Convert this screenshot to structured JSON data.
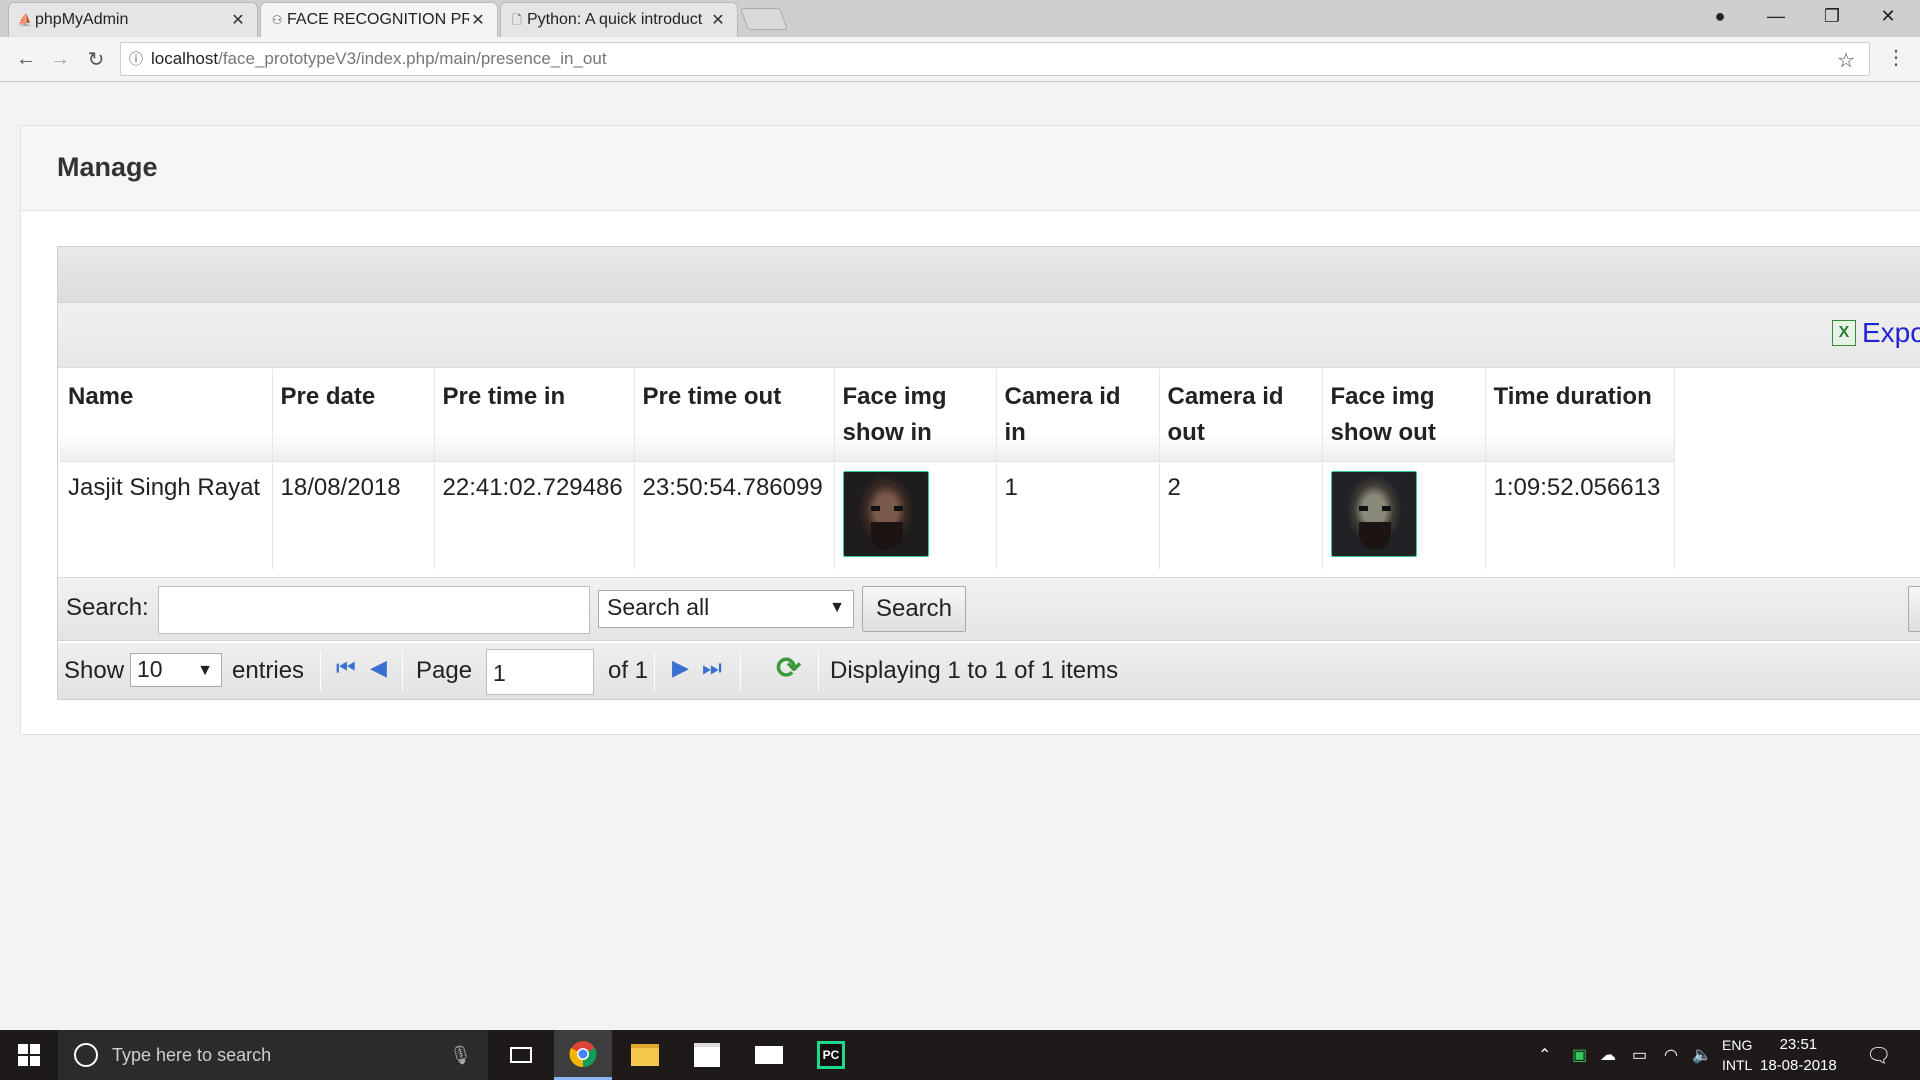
{
  "browser": {
    "tabs": [
      {
        "title": "phpMyAdmin",
        "icon": "phpmyadmin-icon"
      },
      {
        "title": "FACE RECOGNITION PRO",
        "icon": "face-recognition-icon"
      },
      {
        "title": "Python: A quick introduct",
        "icon": "document-icon"
      }
    ],
    "url_host": "localhost",
    "url_path": "/face_prototypeV3/index.php/main/presence_in_out"
  },
  "page": {
    "title": "Manage",
    "export_label": "Expo",
    "table": {
      "headers": [
        {
          "line1": "Name",
          "line2": ""
        },
        {
          "line1": "Pre date",
          "line2": ""
        },
        {
          "line1": "Pre time in",
          "line2": ""
        },
        {
          "line1": "Pre time out",
          "line2": ""
        },
        {
          "line1": "Face img",
          "line2": "show in"
        },
        {
          "line1": "Camera id",
          "line2": "in"
        },
        {
          "line1": "Camera id",
          "line2": "out"
        },
        {
          "line1": "Face img",
          "line2": "show out"
        },
        {
          "line1": "Time duration",
          "line2": ""
        }
      ],
      "rows": [
        {
          "name": "Jasjit Singh Rayat",
          "pre_date": "18/08/2018",
          "pre_time_in": "22:41:02.729486",
          "pre_time_out": "23:50:54.786099",
          "camera_id_in": "1",
          "camera_id_out": "2",
          "time_duration": "1:09:52.056613"
        }
      ]
    },
    "search": {
      "label": "Search:",
      "value": "",
      "select_value": "Search all",
      "button": "Search"
    },
    "pager": {
      "show_label": "Show",
      "page_size": "10",
      "entries_label": "entries",
      "page_label": "Page",
      "page_value": "1",
      "of_label": "of 1",
      "display_text": "Displaying 1 to 1 of 1 items"
    }
  },
  "taskbar": {
    "search_placeholder": "Type here to search",
    "lang1": "ENG",
    "lang2": "INTL",
    "time": "23:51",
    "date": "18-08-2018"
  }
}
